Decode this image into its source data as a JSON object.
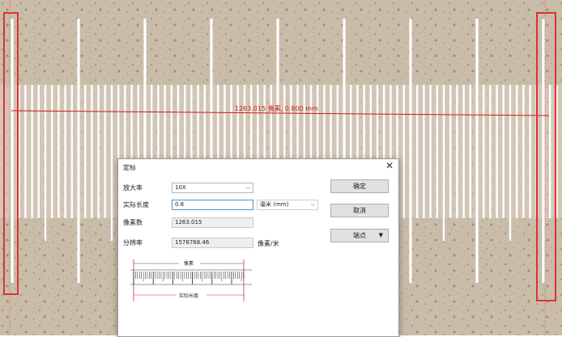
{
  "measurement": {
    "label": "1263.015 像素, 0.800 mm",
    "line_color": "#d01a1a",
    "box_color": "#e03030"
  },
  "dialog": {
    "title": "定标",
    "close_glyph": "✕",
    "magnification": {
      "label": "放大率",
      "value": "10X"
    },
    "actual_length": {
      "label": "实际长度",
      "value": "0.8",
      "unit": "毫米 (mm)"
    },
    "pixel_count": {
      "label": "像素数",
      "value": "1263.015"
    },
    "resolution": {
      "label": "分辨率",
      "value": "1578768.46",
      "unit": "像素/米"
    },
    "buttons": {
      "ok": "确定",
      "cancel": "取消",
      "points": "端点"
    },
    "diagram": {
      "top_label": "像素",
      "bottom_label": "实际长度"
    },
    "icons": {
      "dropdown": "chevron-down-icon",
      "close": "close-icon"
    }
  }
}
